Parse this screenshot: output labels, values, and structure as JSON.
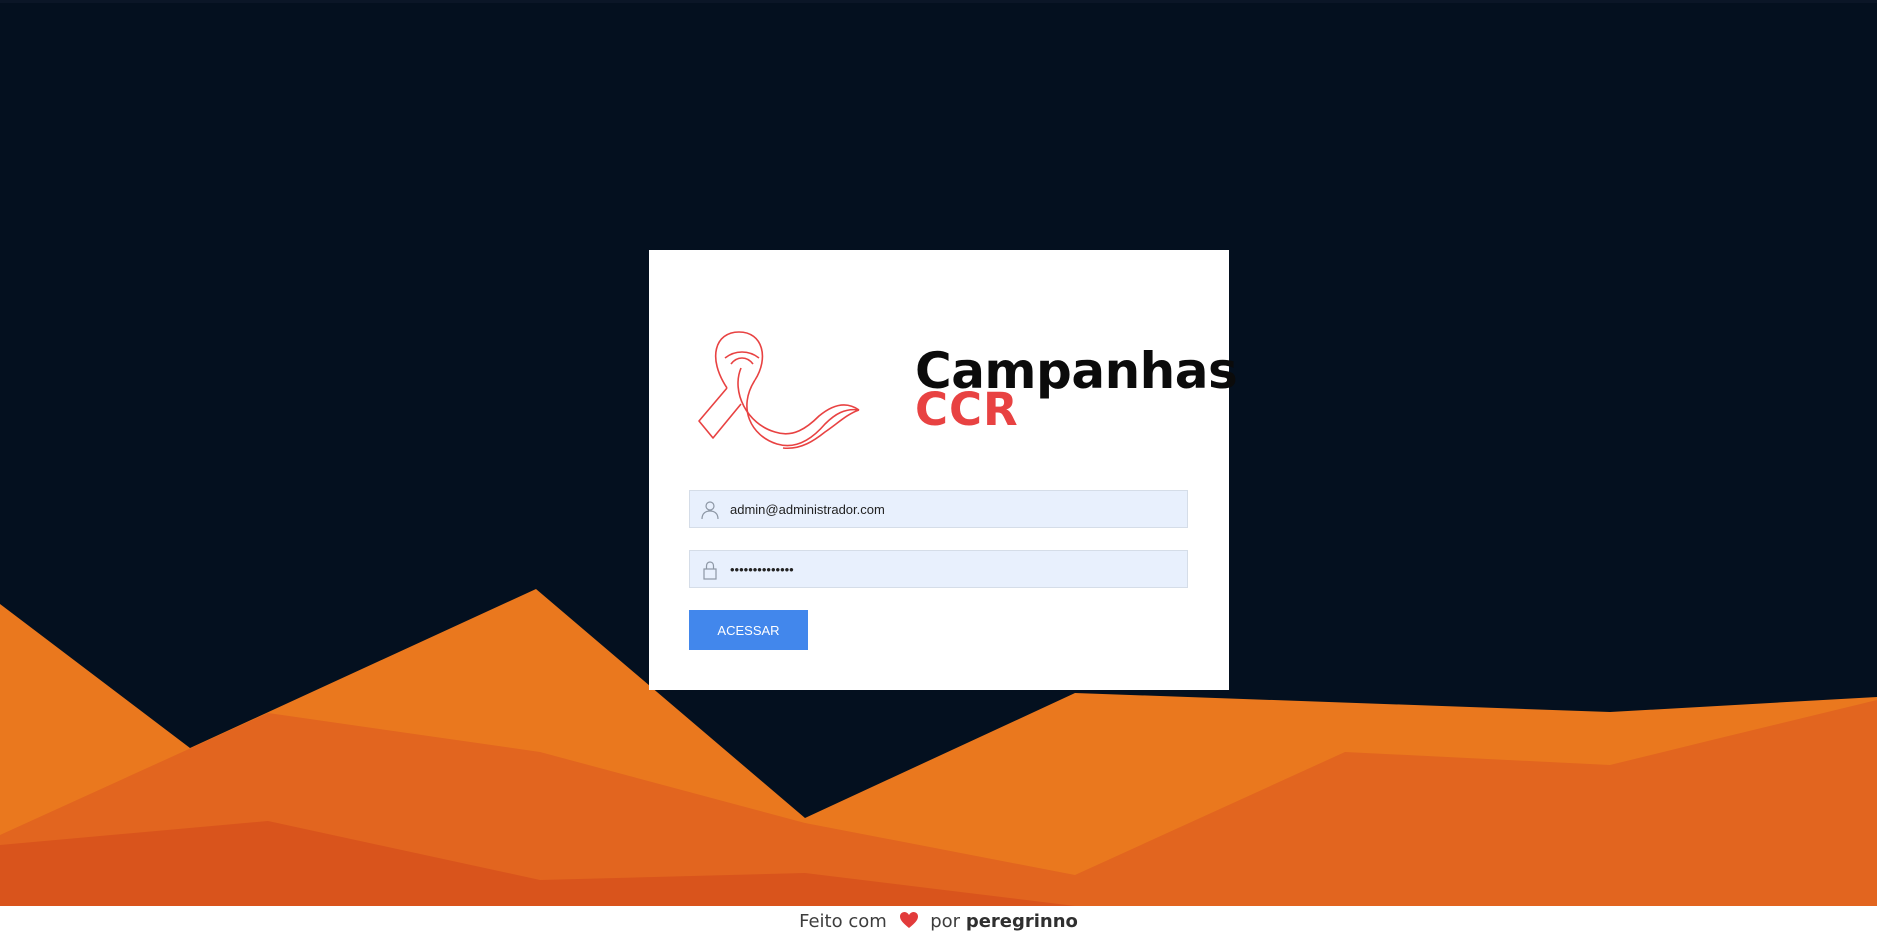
{
  "brand": {
    "title": "Campanhas",
    "subtitle": "CCR",
    "logo_icon": "awareness-ribbon-icon"
  },
  "login": {
    "email_value": "admin@administrador.com",
    "email_icon": "user-icon",
    "password_value": "••••••••••••••",
    "password_icon": "lock-icon",
    "submit_label": "ACESSAR"
  },
  "footer": {
    "prefix": "Feito com",
    "heart_icon": "heart-icon",
    "middle": "por",
    "author": "peregrinno"
  },
  "colors": {
    "background": "#04101f",
    "accent_red": "#e84242",
    "button": "#4287ec",
    "input_bg": "#e8f0fd",
    "mountain_light": "#ea781e",
    "mountain_mid": "#e2651f",
    "mountain_dark": "#d9541c"
  }
}
